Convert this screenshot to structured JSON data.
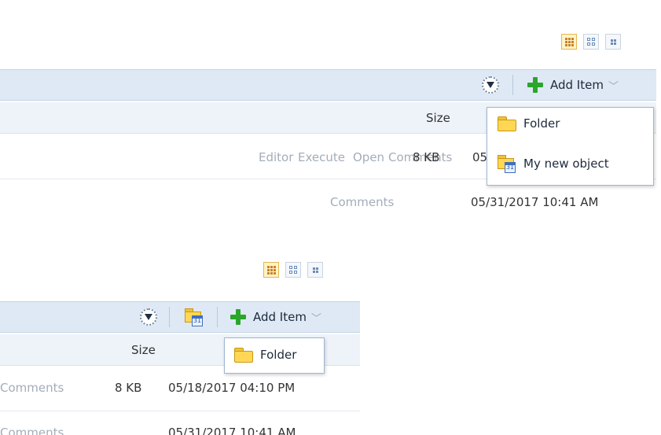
{
  "top": {
    "view_buttons": [
      "list-view",
      "medium-icons-view",
      "small-icons-view"
    ],
    "toolbar": {
      "add_item_label": "Add Item"
    },
    "columns": {
      "size": "Size"
    },
    "row1": {
      "actions": [
        "Editor",
        "Execute",
        "Open",
        "Comments"
      ],
      "size": "8 KB",
      "modified_fragment": "05"
    },
    "row2": {
      "comments": "Comments",
      "modified": "05/31/2017 10:41 AM"
    },
    "menu": [
      {
        "icon": "folder-icon",
        "label": "Folder"
      },
      {
        "icon": "object-icon",
        "label": "My new object"
      }
    ]
  },
  "bottom": {
    "toolbar": {
      "add_item_label": "Add Item"
    },
    "columns": {
      "size": "Size"
    },
    "row1": {
      "comments": "Comments",
      "size": "8 KB",
      "modified": "05/18/2017 04:10 PM"
    },
    "row2": {
      "comments": "Comments",
      "modified": "05/31/2017 10:41 AM"
    },
    "menu": [
      {
        "icon": "folder-icon",
        "label": "Folder"
      }
    ]
  },
  "colors": {
    "toolbar_bg": "#dfe9f5",
    "header_bg": "#edf3f9",
    "accent_green": "#2aa62a",
    "folder_yellow": "#ffd755"
  }
}
